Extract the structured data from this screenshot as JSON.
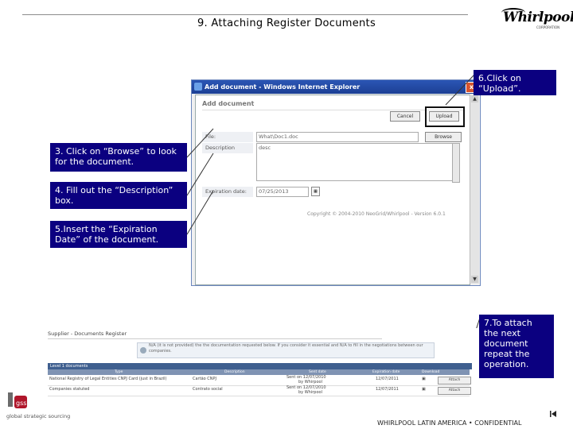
{
  "slide": {
    "title": "9. Attaching Register Documents",
    "footer": "WHIRLPOOL LATIN AMERICA • CONFIDENTIAL",
    "logo": {
      "word": "Whirlpool",
      "tagline": "CORPORATION"
    },
    "gss": {
      "mark": "gss",
      "tagline": "global strategic sourcing"
    }
  },
  "dialog": {
    "window_title": "Add document - Windows Internet Explorer",
    "heading": "Add document",
    "buttons": {
      "cancel": "Cancel",
      "upload": "Upload",
      "browse": "Browse",
      "close": "x"
    },
    "fields": {
      "file_label": "File:",
      "file_value": "What\\Doc1.doc",
      "description_label": "Description",
      "description_value": "desc",
      "expiration_label": "Expiration date:",
      "expiration_value": "07/25/2013"
    },
    "copyright": "Copyright © 2004-2010 NeoGrid/Whirlpool - Version 6.0.1"
  },
  "callouts": {
    "step3": "3. Click on “Browse” to look for the document.",
    "step4": "4. Fill out the “Description” box.",
    "step5": "5.Insert the “Expiration Date” of the document.",
    "step6": "6.Click on “Upload”.",
    "step7": "7.To attach the next document repeat the operation."
  },
  "register": {
    "title": "Supplier - Documents Register",
    "notice": "N/A (it is not provided) the the documentation requested below. If you consider it essential and N/A to fill in the negotiations between our companies.",
    "level_label": "Level 1 documents",
    "columns": [
      "Type",
      "Description",
      "Sent date",
      "Expiration date",
      "Download"
    ],
    "rows": [
      {
        "type": "National Registry of Legal Entities CNPJ Card (just in Brazil)",
        "description": "Cartão CNPJ",
        "sent": "Sent on 12/07/2010",
        "sent_by": "by Whirpool",
        "expiration": "12/07/2011",
        "action": "Attach"
      },
      {
        "type": "Companies statuted",
        "description": "Contrato social",
        "sent": "Sent on 12/07/2010",
        "sent_by": "by Whirpool",
        "expiration": "12/07/2011",
        "action": "Attach"
      }
    ]
  },
  "colors": {
    "callout_bg": "#0b0080",
    "titlebar": "#1c3f94",
    "table_header": "#7f93b3"
  }
}
